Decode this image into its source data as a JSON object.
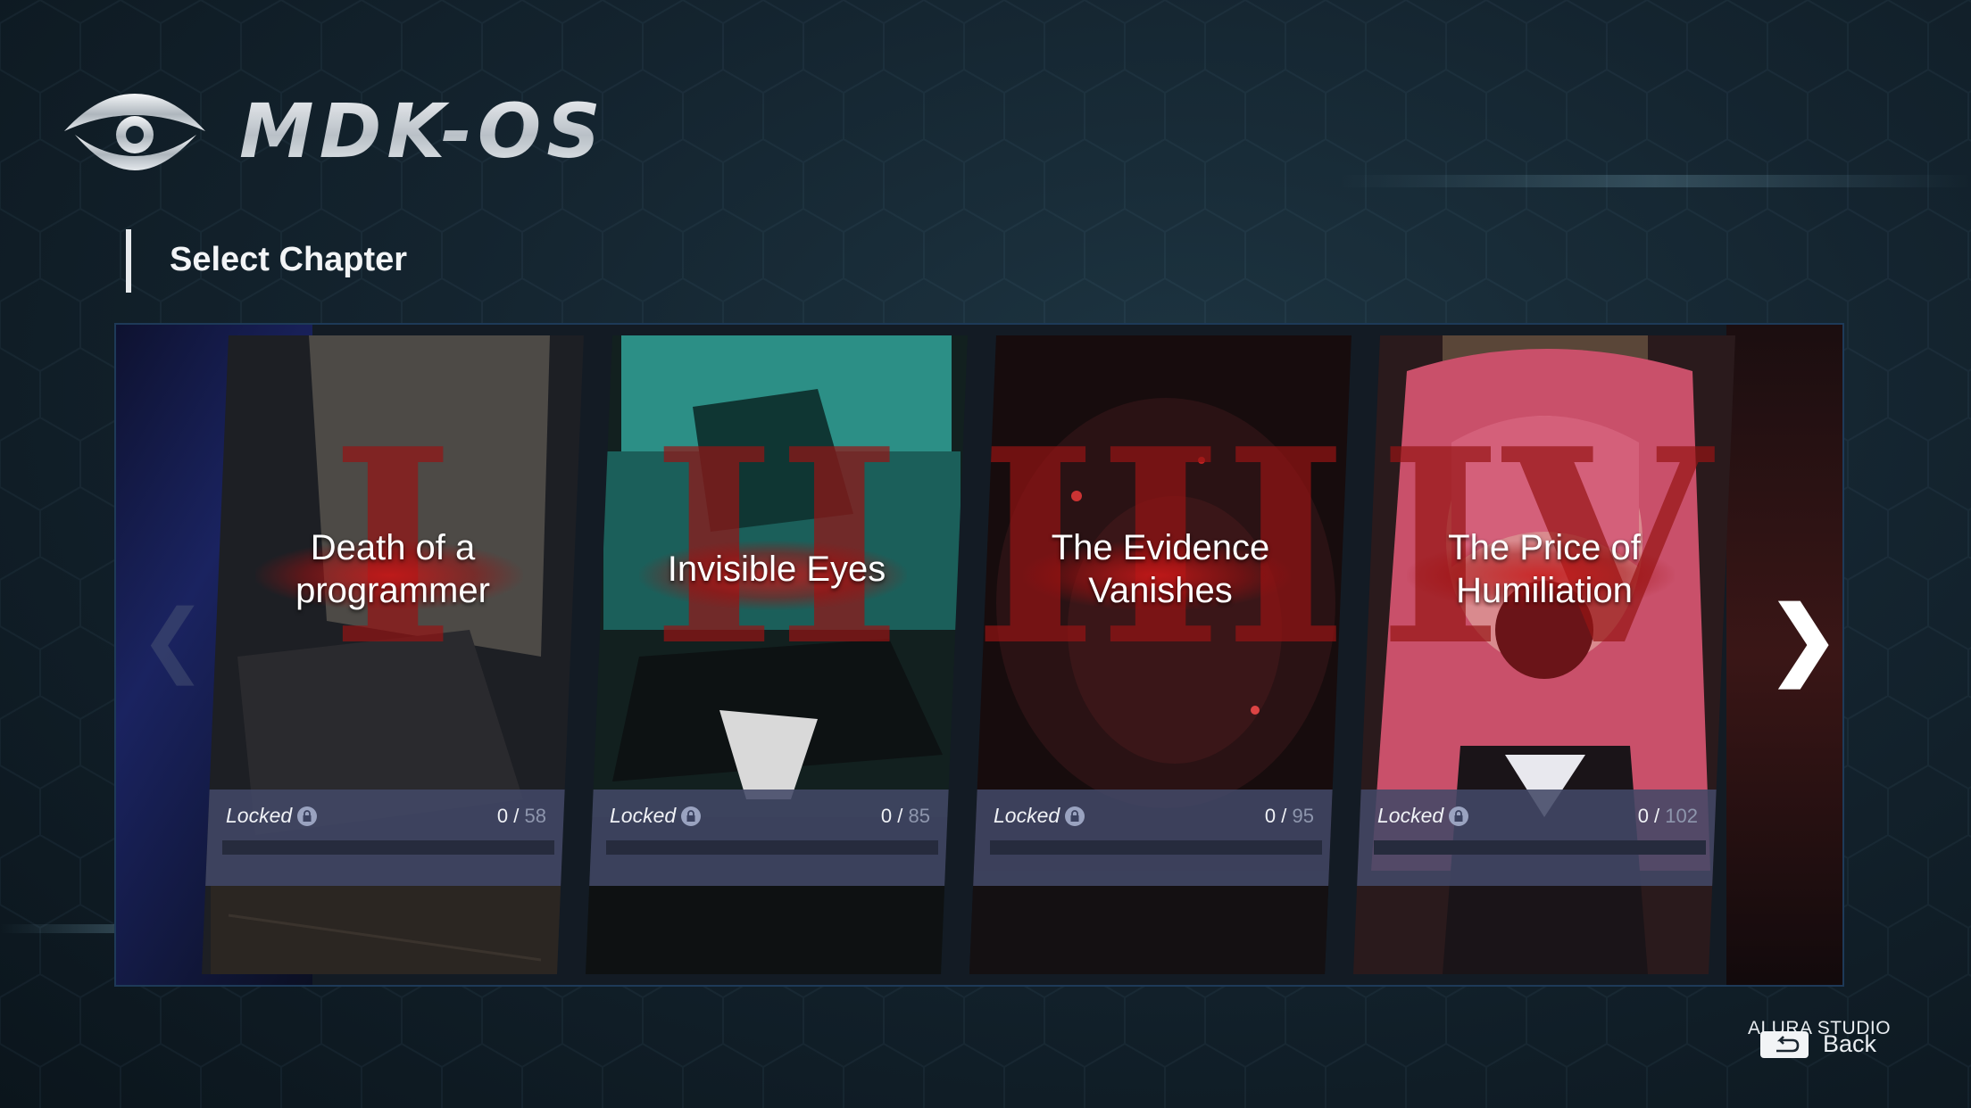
{
  "app": {
    "logo_text": "MDK-OS",
    "logo_icon": "eye-icon"
  },
  "section": {
    "title": "Select Chapter"
  },
  "chapters": [
    {
      "numeral": "I",
      "title": "Death of a programmer",
      "status": "Locked",
      "progress": "0",
      "separator": " / ",
      "total": "58",
      "completion": 0
    },
    {
      "numeral": "II",
      "title": "Invisible Eyes",
      "status": "Locked",
      "progress": "0",
      "separator": " / ",
      "total": "85",
      "completion": 0
    },
    {
      "numeral": "III",
      "title": "The Evidence Vanishes",
      "status": "Locked",
      "progress": "0",
      "separator": " / ",
      "total": "95",
      "completion": 0
    },
    {
      "numeral": "IV",
      "title": "The Price of Humiliation",
      "status": "Locked",
      "progress": "0",
      "separator": " / ",
      "total": "102",
      "completion": 0
    }
  ],
  "navigation": {
    "prev_glyph": "❮",
    "next_glyph": "❯"
  },
  "footer": {
    "studio": "ALURA STUDIO",
    "back_label": "Back",
    "back_icon": "return-arrow-icon"
  },
  "colors": {
    "accent_red": "#a01818",
    "panel": "#424866",
    "background": "#14242f"
  }
}
